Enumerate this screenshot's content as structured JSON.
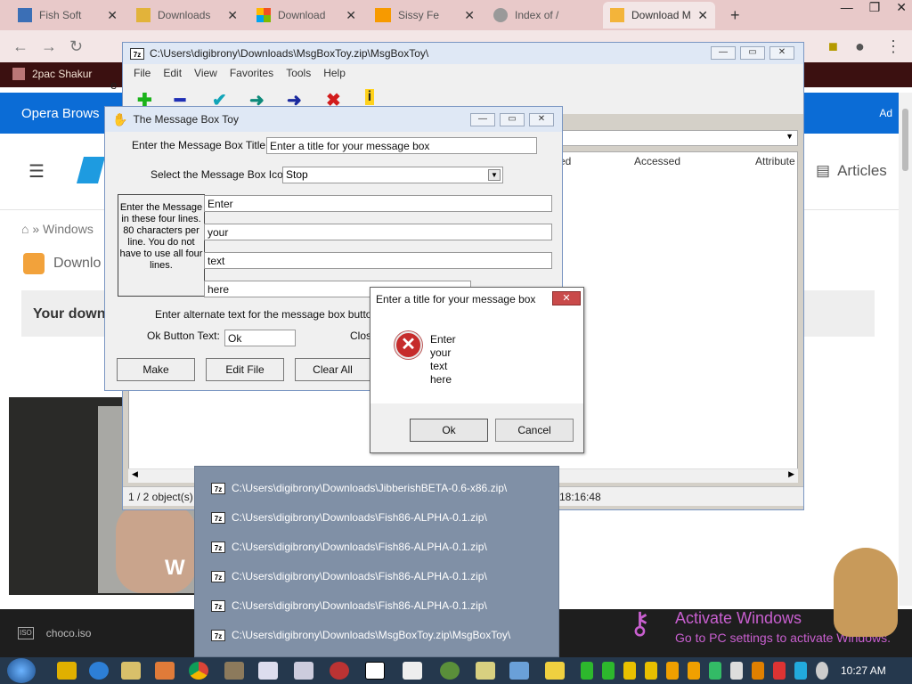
{
  "browser": {
    "tabs": [
      {
        "label": "Fish Soft",
        "active": false
      },
      {
        "label": "Downloads",
        "active": false
      },
      {
        "label": "Download",
        "active": false
      },
      {
        "label": "Sissy Fe",
        "active": false
      },
      {
        "label": "Index of /",
        "active": false
      },
      {
        "label": "Download M",
        "active": true
      }
    ],
    "new_tab": "+",
    "bookmark": "2pac Shakur",
    "address_partial": "e"
  },
  "page": {
    "banner": "Opera Brows",
    "banner_ad": "Ad",
    "articles": "Articles",
    "breadcrumb": "» Windows",
    "download_title": "Downlo",
    "grey_box": "Your down",
    "video_text": "W"
  },
  "sevenzip": {
    "title": "C:\\Users\\digibrony\\Downloads\\MsgBoxToy.zip\\MsgBoxToy\\",
    "title_icon": "7z",
    "menu": [
      "File",
      "Edit",
      "View",
      "Favorites",
      "Tools",
      "Help"
    ],
    "columns": [
      "ated",
      "Accessed",
      "Attribute"
    ],
    "status_left": "1 / 2 object(s)",
    "status_time": "18:16:48"
  },
  "msgboxtoy": {
    "title": "The Message Box Toy",
    "title_label": "Enter the Message Box Title:",
    "title_value": "Enter a title for your message box",
    "icon_label": "Select the Message Box Icon:",
    "icon_value": "Stop",
    "instructions": "Enter the Message in these four lines. 80 characters per line.  You do not have to use all four lines.",
    "lines": [
      "Enter",
      "your",
      "text",
      "here"
    ],
    "alt_text_label": "Enter alternate text for the message box buttons,  a",
    "ok_label": "Ok Button Text:",
    "ok_value": "Ok",
    "close_label": "Close",
    "buttons": {
      "make": "Make",
      "edit": "Edit File",
      "clear": "Clear All"
    }
  },
  "dialog": {
    "title": "Enter a title for your message box",
    "close": "✕",
    "lines": [
      "Enter",
      "your",
      "text",
      "here"
    ],
    "ok": "Ok",
    "cancel": "Cancel"
  },
  "jumplist": {
    "items": [
      "C:\\Users\\digibrony\\Downloads\\JibberishBETA-0.6-x86.zip\\",
      "C:\\Users\\digibrony\\Downloads\\Fish86-ALPHA-0.1.zip\\",
      "C:\\Users\\digibrony\\Downloads\\Fish86-ALPHA-0.1.zip\\",
      "C:\\Users\\digibrony\\Downloads\\Fish86-ALPHA-0.1.zip\\",
      "C:\\Users\\digibrony\\Downloads\\Fish86-ALPHA-0.1.zip\\",
      "C:\\Users\\digibrony\\Downloads\\MsgBoxToy.zip\\MsgBoxToy\\"
    ]
  },
  "download_bar": {
    "file": "choco.iso",
    "ext_label": "ISO"
  },
  "watermark": {
    "line1": "Activate Windows",
    "line2": "Go to PC settings to activate Windows."
  },
  "taskbar": {
    "clock": "10:27 AM"
  }
}
